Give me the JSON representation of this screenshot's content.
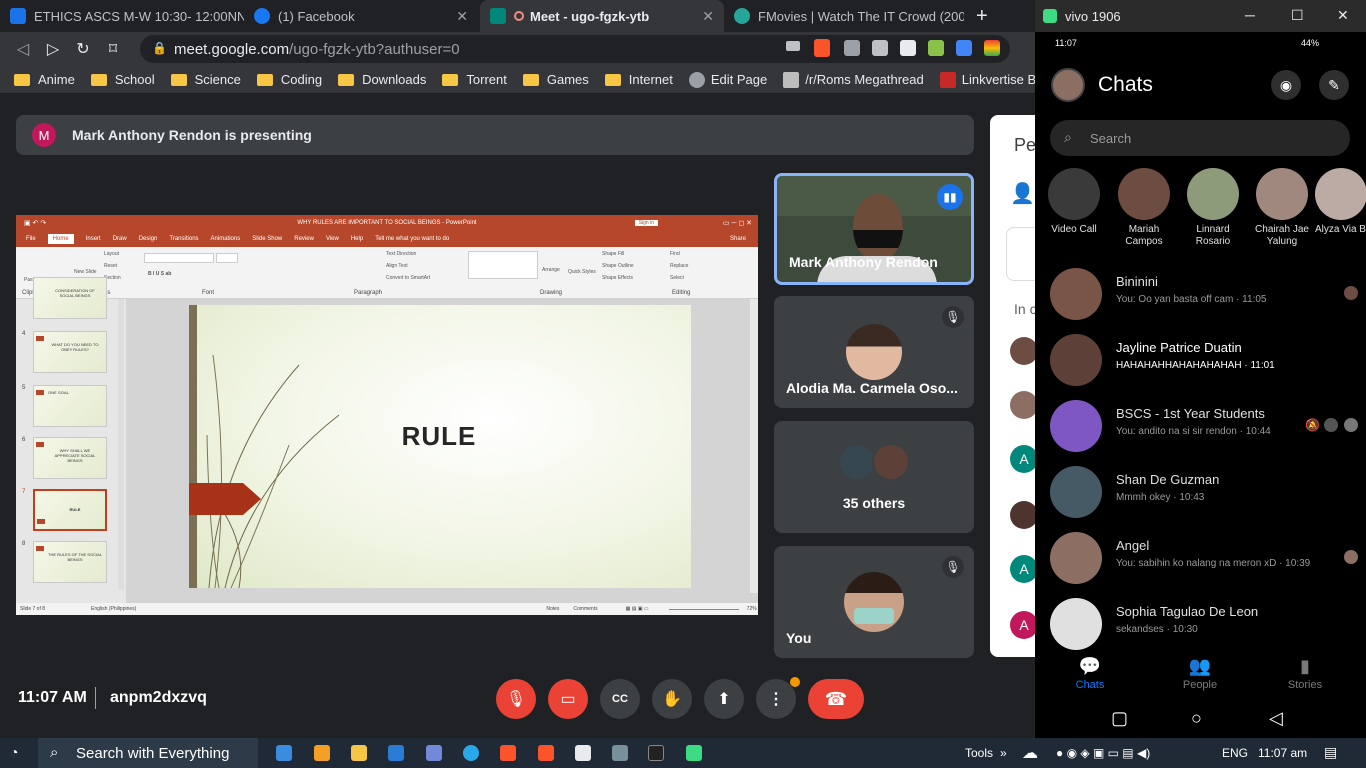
{
  "browser": {
    "tabs": [
      {
        "title": "ETHICS ASCS M-W 10:30- 12:00NN AS",
        "color": "#1a73e8"
      },
      {
        "title": "(1) Facebook",
        "color": "#1877f2"
      },
      {
        "title": "Meet - ugo-fgzk-ytb",
        "color": "#00897b"
      },
      {
        "title": "FMovies | Watch The IT Crowd (2006) |",
        "color": "#26a69a"
      }
    ],
    "new_tab": "+",
    "url_host": "meet.google.com",
    "url_path": "/ugo-fgzk-ytb?authuser=0",
    "bookmarks": [
      "Anime",
      "School",
      "Science",
      "Coding",
      "Downloads",
      "Torrent",
      "Games",
      "Internet",
      "Edit Page",
      "/r/Roms Megathread",
      "Linkvertise Bypasser"
    ]
  },
  "meet": {
    "presenter_initial": "M",
    "presenting_text": "Mark Anthony Rendon is presenting",
    "participants": {
      "presenter": "Mark Anthony Rendon",
      "second": "Alodia Ma. Carmela Oso...",
      "others": "35 others",
      "self": "You"
    },
    "people_panel": {
      "title": "Pe",
      "in_call": "In c",
      "avatar_letter": "A"
    },
    "time": "11:07 AM",
    "meeting_code": "anpm2dxzvq"
  },
  "powerpoint": {
    "title": "WHY RULES ARE IMPORTANT TO SOCIAL BEINGS - PowerPoint",
    "sign_in": "Sign in",
    "menu": [
      "File",
      "Home",
      "Insert",
      "Draw",
      "Design",
      "Transitions",
      "Animations",
      "Slide Show",
      "Review",
      "View",
      "Help",
      "Tell me what you want to do",
      "Share"
    ],
    "groups": [
      "Clipboard",
      "Slides",
      "Font",
      "Paragraph",
      "Drawing",
      "Editing"
    ],
    "ribbon": {
      "paste": "Paste",
      "new_slide": "New Slide",
      "layout": "Layout",
      "reset": "Reset",
      "section": "Section",
      "text_direction": "Text Direction",
      "align_text": "Align Text",
      "convert_smartart": "Convert to SmartArt",
      "arrange": "Arrange",
      "quick_styles": "Quick Styles",
      "shape_fill": "Shape Fill",
      "shape_outline": "Shape Outline",
      "shape_effects": "Shape Effects",
      "find": "Find",
      "replace": "Replace",
      "select": "Select"
    },
    "thumbnails": [
      {
        "num": "",
        "text": "CONSIDERATION OF SOCIAL BEINGS"
      },
      {
        "num": "4",
        "text": "WHAT DO YOU NEED TO OBEY RULES?"
      },
      {
        "num": "5",
        "text": "ONE GOAL"
      },
      {
        "num": "6",
        "text": "WHY SHALL WE APPRECIATE SOCIAL BEINGS"
      },
      {
        "num": "7",
        "text": "RULE"
      },
      {
        "num": "8",
        "text": "THE RULES OF THE SOCIAL BEINGS"
      }
    ],
    "slide_title": "RULE",
    "status": {
      "slide": "Slide 7 of 8",
      "language": "English (Philippines)",
      "notes": "Notes",
      "comments": "Comments",
      "zoom": "72%"
    }
  },
  "phone": {
    "window_title": "vivo 1906",
    "status_time": "11:07",
    "battery": "44%",
    "chats_title": "Chats",
    "search_placeholder": "Search",
    "stories": [
      {
        "name": "Video Call",
        "color": "#3a3a3a"
      },
      {
        "name": "Mariah Campos",
        "color": "#6d4c41"
      },
      {
        "name": "Linnard Rosario",
        "color": "#8d9b7a"
      },
      {
        "name": "Chairah Jae Yalung",
        "color": "#a1887f"
      },
      {
        "name": "Alyza Via Banaag",
        "color": "#bcaaa4"
      }
    ],
    "chats": [
      {
        "name": "Bininini",
        "message": "You: Oo yan basta off cam · 11:05",
        "color": "#795548",
        "unread": false
      },
      {
        "name": "Jayline Patrice Duatin",
        "message": "HAHAHAHHAHAHAHAHAH · 11:01",
        "color": "#5d4037",
        "unread": true
      },
      {
        "name": "BSCS - 1st Year Students",
        "message": "You: andito na si sir rendon · 10:44",
        "color": "#7e57c2",
        "unread": false
      },
      {
        "name": "Shan De Guzman",
        "message": "Mmmh okey · 10:43",
        "color": "#455a64",
        "unread": false
      },
      {
        "name": "Angel",
        "message": "You: sabihin ko nalang na meron xD · 10:39",
        "color": "#8d6e63",
        "unread": false
      },
      {
        "name": "Sophia Tagulao De Leon",
        "message": "sekandses · 10:30",
        "color": "#e0e0e0",
        "unread": false
      }
    ],
    "nav": [
      "Chats",
      "People",
      "Stories"
    ],
    "accent": "#0a7cff"
  },
  "taskbar": {
    "search": "Search with Everything",
    "tools": "Tools",
    "language": "ENG",
    "time": "11:07 am"
  }
}
